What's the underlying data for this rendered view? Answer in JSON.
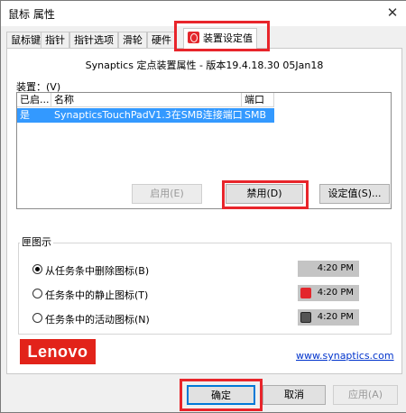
{
  "window": {
    "title": "鼠标 属性",
    "close_glyph": "✕"
  },
  "tabs": [
    {
      "label": "鼠标键"
    },
    {
      "label": "指针"
    },
    {
      "label": "指针选项"
    },
    {
      "label": "滑轮"
    },
    {
      "label": "硬件"
    },
    {
      "label": "装置设定值",
      "active": true,
      "icon": "synaptics-icon"
    }
  ],
  "header": "Synaptics 定点装置属性 - 版本19.4.18.30 05Jan18",
  "devices": {
    "label": "装置：(V)",
    "columns": [
      "已启...",
      "名称",
      "端口"
    ],
    "rows": [
      {
        "enabled": "是",
        "name": "SynapticsTouchPadV1.3在SMB连接端口",
        "port": "SMB",
        "selected": true
      }
    ]
  },
  "device_buttons": {
    "enable": "启用(E)",
    "disable": "禁用(D)",
    "settings": "设定值(S)..."
  },
  "tray": {
    "title": "匣图示",
    "options": [
      {
        "label": "从任务条中删除图标(B)",
        "selected": true,
        "time": "4:20 PM",
        "icon": ""
      },
      {
        "label": "任务条中的静止图标(T)",
        "selected": false,
        "time": "4:20 PM",
        "icon": "synaptics-static-icon"
      },
      {
        "label": "任务条中的活动图标(N)",
        "selected": false,
        "time": "4:20 PM",
        "icon": "touchpad-active-icon"
      }
    ]
  },
  "branding": {
    "logo": "Lenovo",
    "link": "www.synaptics.com"
  },
  "footer": {
    "ok": "确定",
    "cancel": "取消",
    "apply": "应用(A)"
  },
  "colors": {
    "highlight": "#e8252b",
    "selection": "#3399ff",
    "brand": "#e2231a",
    "link": "#0033cc"
  }
}
